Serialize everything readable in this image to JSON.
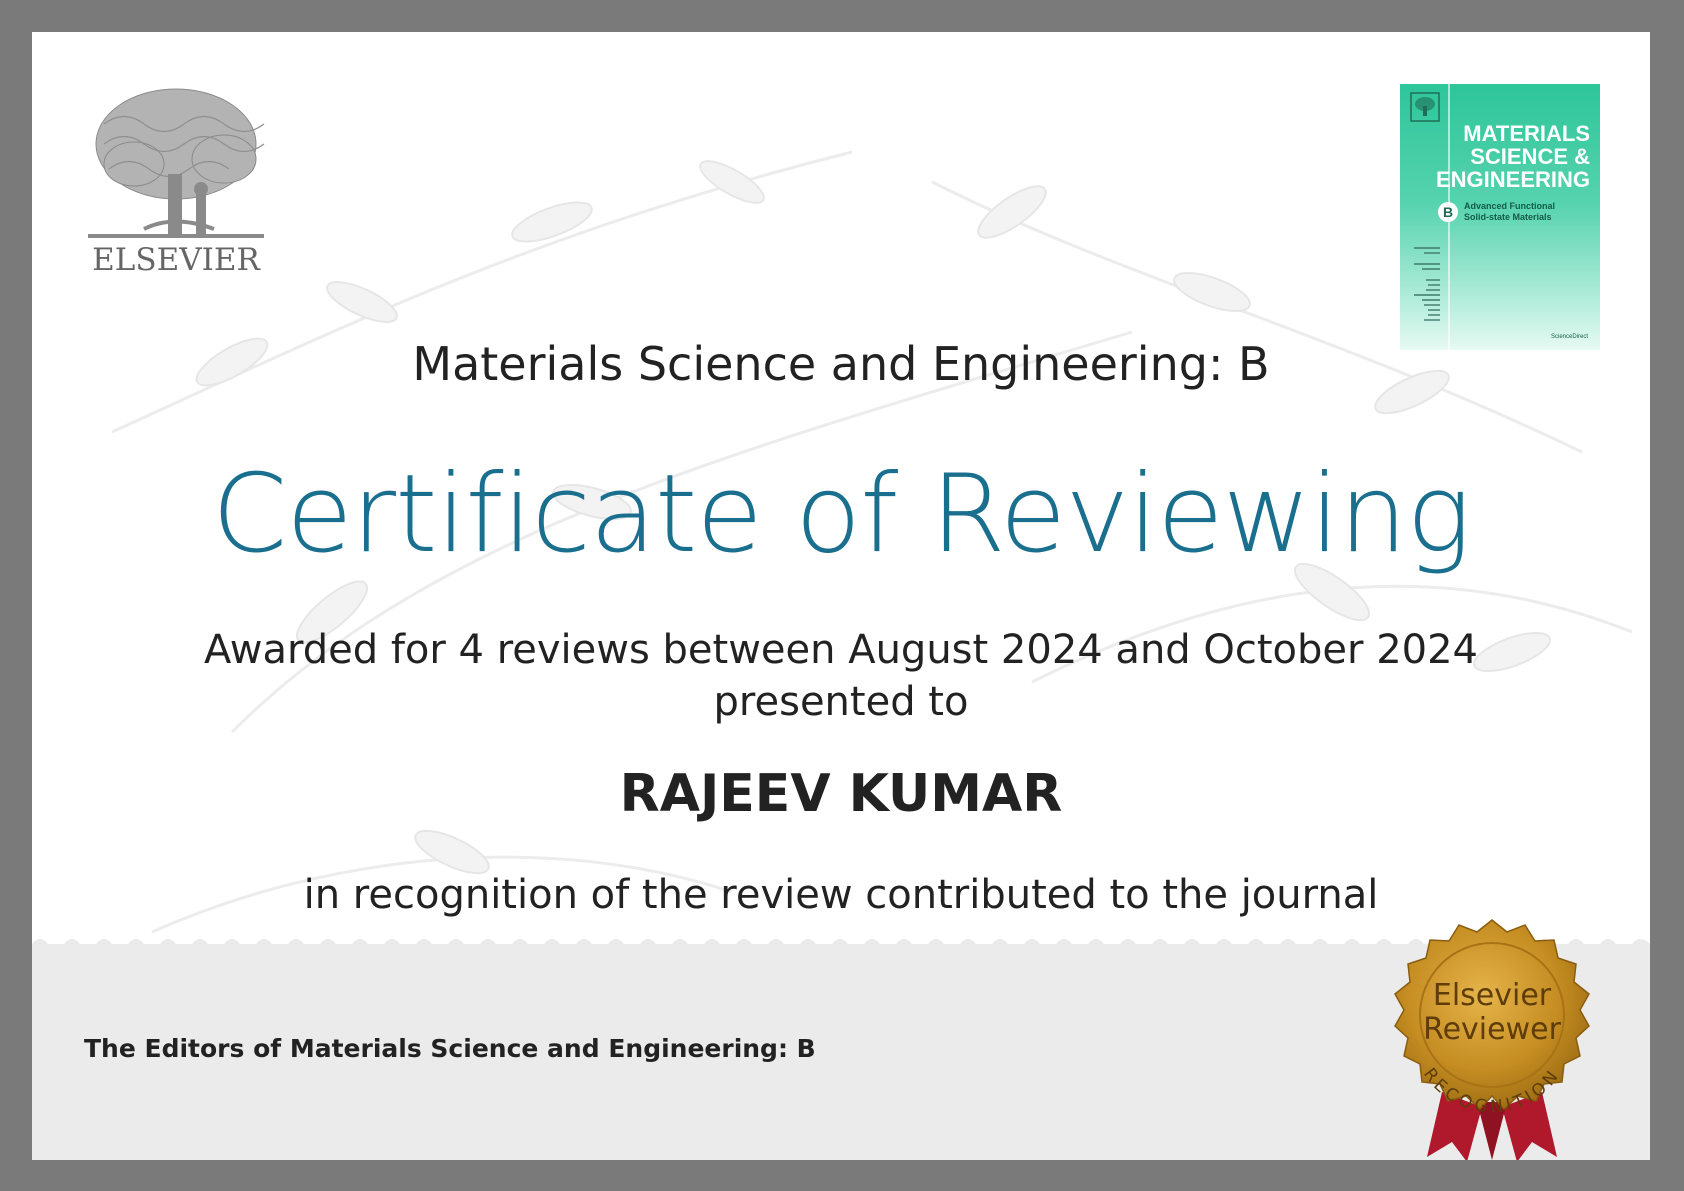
{
  "publisher": {
    "name": "ELSEVIER"
  },
  "cover": {
    "title_lines": [
      "MATERIALS",
      "SCIENCE &",
      "ENGINEERING"
    ],
    "badge": "B",
    "subtitle_lines": [
      "Advanced Functional",
      "Solid-state Materials"
    ],
    "footer": "ScienceDirect"
  },
  "certificate": {
    "journal": "Materials Science and Engineering: B",
    "title": "Certificate of Reviewing",
    "awarded_line": "Awarded for 4 reviews between August 2024 and October 2024",
    "presented_line": "presented to",
    "recipient": "RAJEEV KUMAR",
    "recognition_line": "in recognition of the review contributed to the journal",
    "signatory": "The Editors of Materials Science and Engineering: B"
  },
  "seal": {
    "line1": "Elsevier",
    "line2": "Reviewer",
    "arc_text": "RECOGNITION"
  },
  "colors": {
    "frame": "#7a7a7a",
    "title": "#1a6f8e",
    "cover": "#2ec59a",
    "seal_gold": "#c08a1e",
    "ribbon": "#b0182b"
  }
}
